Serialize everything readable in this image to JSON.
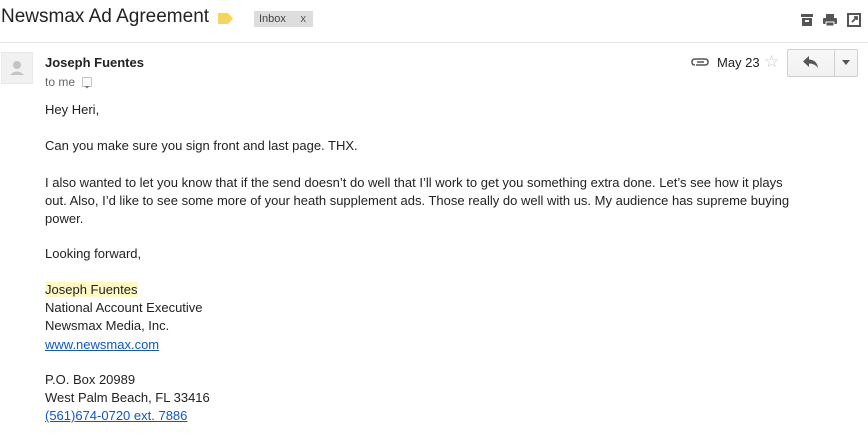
{
  "subject": "Newsmax Ad Agreement",
  "label": {
    "name": "Inbox",
    "remove": "x"
  },
  "message": {
    "sender": "Joseph Fuentes",
    "recipient": "to me",
    "date": "May 23",
    "greeting": "Hey Heri,",
    "p1": "Can you make sure you sign front and last page. THX.",
    "p2_lines": [
      "I also wanted to let you know that if the send doesn’t do well that I’ll work to get you something extra done. Let’s see how it plays",
      "out. Also, I’d like to see some more of your heath supplement ads. Those really do well with us. My audience has supreme buying",
      "power."
    ],
    "closing": "Looking forward,",
    "signature": {
      "name": "Joseph Fuentes",
      "title": "National Account Executive",
      "company": "Newsmax Media, Inc.",
      "website": "www.newsmax.com",
      "po_box": "P.O. Box 20989",
      "city": "West Palm Beach, FL 33416",
      "phone": "(561)674-0720 ext. 7886"
    }
  },
  "icons": {
    "label_tag": "tag-icon",
    "print_all": "print-icon",
    "new_window": "new-window-icon",
    "archive_top": "archive-icon",
    "attachment": "paperclip-icon",
    "star": "star-icon",
    "reply": "reply-icon",
    "more": "chevron-down-icon"
  },
  "colors": {
    "link": "#1155cc",
    "highlight": "#fff9c4",
    "tag": "#f6d55c",
    "chip": "#dddddd"
  }
}
